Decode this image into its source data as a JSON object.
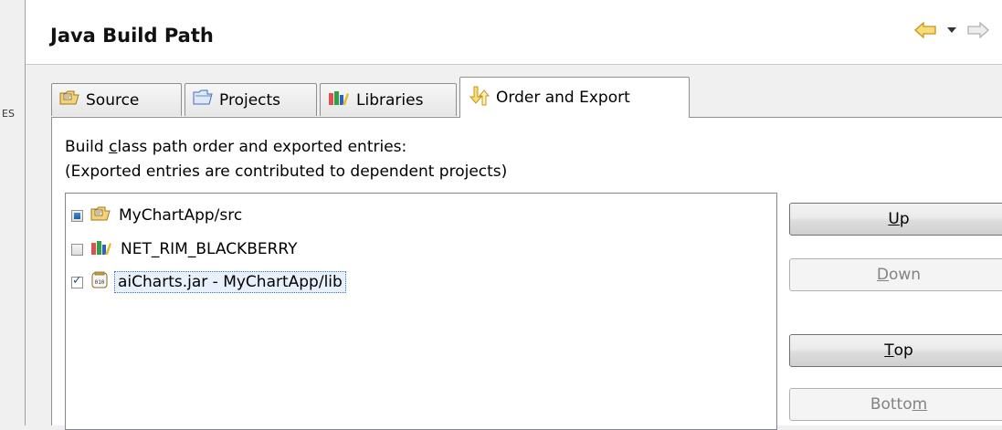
{
  "left_strip": {
    "glyph": "ES"
  },
  "header": {
    "title": "Java Build Path"
  },
  "tabs": [
    {
      "label": "Source",
      "icon": "source-folder-icon"
    },
    {
      "label": "Projects",
      "icon": "projects-folder-icon"
    },
    {
      "label": "Libraries",
      "icon": "libraries-icon"
    },
    {
      "label": "Order and Export",
      "icon": "order-export-icon"
    }
  ],
  "panel": {
    "desc_prefix": "Build ",
    "desc_underline": "c",
    "desc_rest": "lass path order and exported entries:",
    "desc2": "(Exported entries are contributed to dependent projects)"
  },
  "entries": [
    {
      "label": "MyChartApp/src",
      "state": "grayed",
      "icon": "source-folder-icon"
    },
    {
      "label": "NET_RIM_BLACKBERRY",
      "state": "unchecked",
      "icon": "library-icon"
    },
    {
      "label": "aiCharts.jar - MyChartApp/lib",
      "state": "checked",
      "icon": "jar-icon"
    }
  ],
  "buttons": {
    "up_mn": "U",
    "up_rest": "p",
    "down_mn": "D",
    "down_rest": "own",
    "top_mn": "T",
    "top_rest": "op",
    "bottom_pre": "Botto",
    "bottom_mn": "m"
  },
  "colors": {
    "accent": "#3874c8",
    "nav_arrow": "#e8b830"
  }
}
